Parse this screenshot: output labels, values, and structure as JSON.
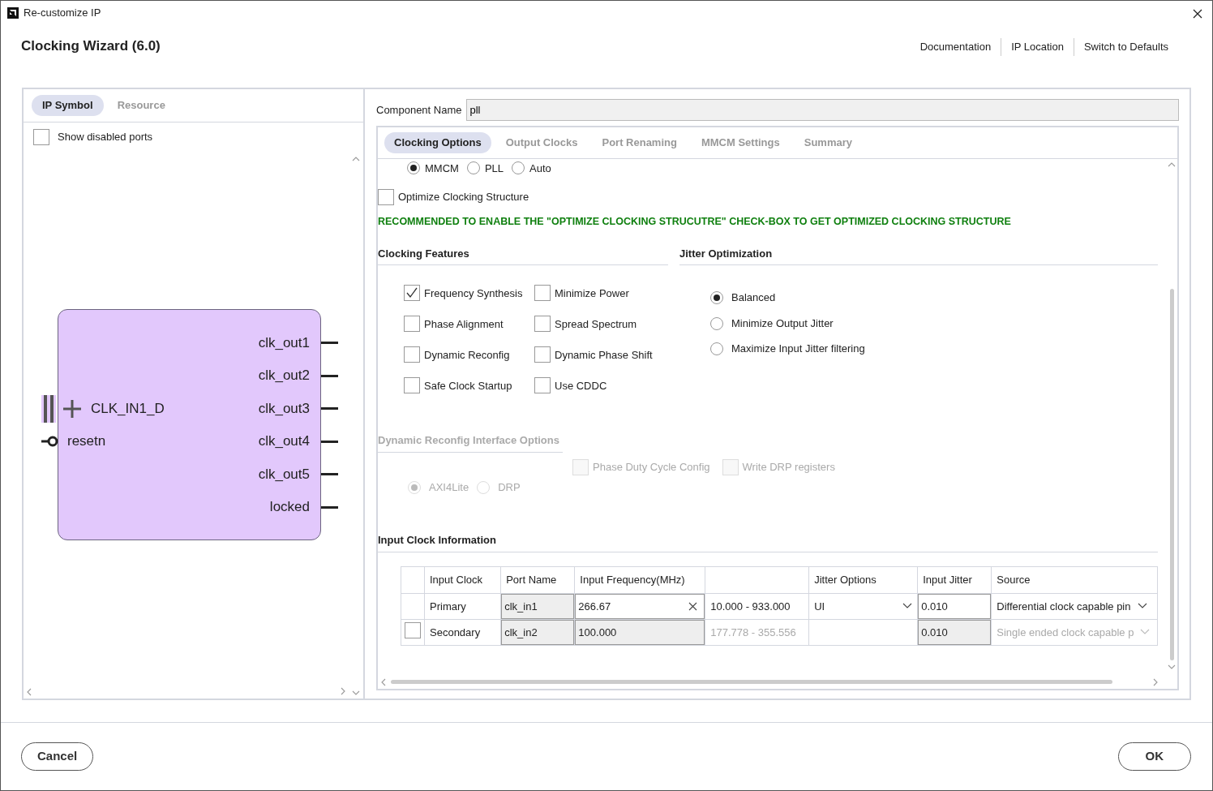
{
  "window": {
    "title": "Re-customize IP"
  },
  "header": {
    "title": "Clocking Wizard (6.0)",
    "links": [
      "Documentation",
      "IP Location",
      "Switch to Defaults"
    ]
  },
  "left_panel": {
    "tabs": [
      {
        "label": "IP Symbol",
        "selected": true
      },
      {
        "label": "Resource",
        "selected": false
      }
    ],
    "show_disabled_ports": {
      "label": "Show disabled ports",
      "checked": false
    },
    "symbol": {
      "inputs": [
        {
          "name": "CLK_IN1_D",
          "kind": "bus"
        },
        {
          "name": "resetn",
          "kind": "active_low"
        }
      ],
      "outputs": [
        "clk_out1",
        "clk_out2",
        "clk_out3",
        "clk_out4",
        "clk_out5",
        "locked"
      ]
    }
  },
  "component_name": {
    "label": "Component Name",
    "value": "pll"
  },
  "tabs": [
    {
      "label": "Clocking Options",
      "selected": true
    },
    {
      "label": "Output Clocks",
      "selected": false
    },
    {
      "label": "Port Renaming",
      "selected": false
    },
    {
      "label": "MMCM Settings",
      "selected": false
    },
    {
      "label": "Summary",
      "selected": false
    }
  ],
  "primitive": [
    {
      "label": "MMCM",
      "selected": true
    },
    {
      "label": "PLL",
      "selected": false
    },
    {
      "label": "Auto",
      "selected": false
    }
  ],
  "optimize": {
    "label": "Optimize Clocking Structure",
    "checked": false
  },
  "recommendation": "RECOMMENDED TO ENABLE THE \"OPTIMIZE CLOCKING STRUCUTRE\" CHECK-BOX TO GET OPTIMIZED CLOCKING STRUCTURE",
  "clocking_features": {
    "title": "Clocking Features",
    "options": [
      {
        "label": "Frequency Synthesis",
        "checked": true
      },
      {
        "label": "Minimize Power",
        "checked": false
      },
      {
        "label": "Phase Alignment",
        "checked": false
      },
      {
        "label": "Spread Spectrum",
        "checked": false
      },
      {
        "label": "Dynamic Reconfig",
        "checked": false
      },
      {
        "label": "Dynamic Phase Shift",
        "checked": false
      },
      {
        "label": "Safe Clock Startup",
        "checked": false
      },
      {
        "label": "Use CDDC",
        "checked": false
      }
    ]
  },
  "jitter_optimization": {
    "title": "Jitter Optimization",
    "options": [
      {
        "label": "Balanced",
        "selected": true
      },
      {
        "label": "Minimize Output Jitter",
        "selected": false
      },
      {
        "label": "Maximize Input Jitter filtering",
        "selected": false
      }
    ]
  },
  "dynamic_reconfig_interface": {
    "title": "Dynamic Reconfig Interface Options",
    "disabled": true,
    "checkboxes": [
      {
        "label": "Phase Duty Cycle Config",
        "checked": false
      },
      {
        "label": "Write DRP registers",
        "checked": false
      }
    ],
    "interface": [
      {
        "label": "AXI4Lite",
        "selected": true
      },
      {
        "label": "DRP",
        "selected": false
      }
    ]
  },
  "input_clock_information": {
    "title": "Input Clock Information",
    "columns": [
      "Input Clock",
      "Port Name",
      "Input Frequency(MHz)",
      "Jitter Options",
      "Input Jitter",
      "Source"
    ],
    "rows": [
      {
        "kind": "fixed",
        "input_clock": "Primary",
        "port_name": "clk_in1",
        "frequency": "266.67",
        "range": "10.000 - 933.000",
        "jitter_option": "UI",
        "input_jitter": "0.010",
        "source": "Differential clock capable pin",
        "disabled": false
      },
      {
        "kind": "optional",
        "checked": false,
        "input_clock": "Secondary",
        "port_name": "clk_in2",
        "frequency": "100.000",
        "range": "177.778 - 355.556",
        "input_jitter": "0.010",
        "source": "Single ended clock capable p",
        "disabled": true
      }
    ]
  },
  "footer": {
    "buttons": [
      "Cancel",
      "OK"
    ]
  }
}
